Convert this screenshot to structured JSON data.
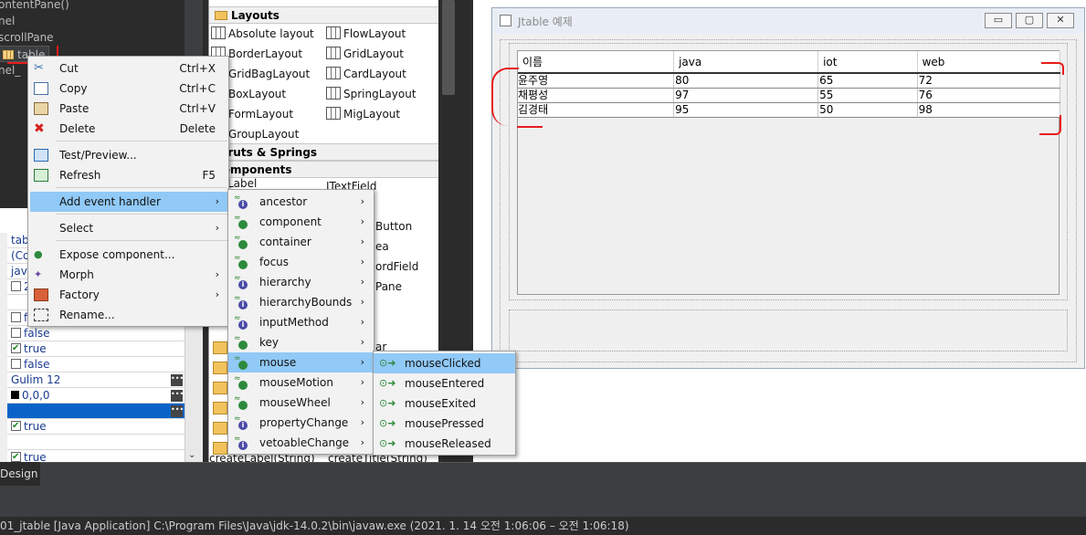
{
  "tree": {
    "items": [
      "ontentPane()",
      "nel",
      "scrollPane",
      "table",
      "nel_"
    ]
  },
  "props": {
    "rows": [
      {
        "text": "tab",
        "check": null
      },
      {
        "text": "(Co",
        "check": null
      },
      {
        "text": "java",
        "check": null
      },
      {
        "text": "2",
        "check": "off"
      },
      {
        "text": "",
        "check": null
      },
      {
        "text": "f",
        "check": "off"
      },
      {
        "text": "false",
        "check": "off"
      },
      {
        "text": "true",
        "check": "on"
      },
      {
        "text": "false",
        "check": "off"
      },
      {
        "text": "Gulim 12",
        "check": null,
        "dots": true
      },
      {
        "text": "0,0,0",
        "check": null,
        "dots": true,
        "swatch": true
      },
      {
        "text": "",
        "check": null,
        "dots": true,
        "selected": true
      },
      {
        "text": "true",
        "check": "on"
      },
      {
        "text": "",
        "check": null
      },
      {
        "text": "true",
        "check": "on"
      }
    ]
  },
  "palette": {
    "layouts_header": "Layouts",
    "layouts": [
      [
        "Absolute layout",
        "FlowLayout"
      ],
      [
        "BorderLayout",
        "GridLayout"
      ],
      [
        "GridBagLayout",
        "CardLayout"
      ],
      [
        "BoxLayout",
        "SpringLayout"
      ],
      [
        "FormLayout",
        "MigLayout"
      ],
      [
        "GroupLayout",
        ""
      ]
    ],
    "struts_header": "Struts & Springs",
    "components_header": "Components",
    "components_right": [
      "JTextField",
      "",
      "Button",
      "ea",
      "ordField",
      "Pane",
      "",
      "",
      "ar"
    ],
    "components_left_top": "Label",
    "bottom_row": [
      "createLabel(String)",
      "createTitle(String)"
    ]
  },
  "frame": {
    "title": "Jtable 예제",
    "btn_min": "▭",
    "btn_max": "▢",
    "btn_close": "✕"
  },
  "table": {
    "columns": [
      "이름",
      "java",
      "iot",
      "web"
    ],
    "rows": [
      [
        "윤주영",
        "80",
        "65",
        "72"
      ],
      [
        "채평성",
        "97",
        "55",
        "76"
      ],
      [
        "김경태",
        "95",
        "50",
        "98"
      ]
    ]
  },
  "context_menu": {
    "items": [
      {
        "label": "Cut",
        "shortcut": "Ctrl+X",
        "icon": "scissors-icon"
      },
      {
        "label": "Copy",
        "shortcut": "Ctrl+C",
        "icon": "copy-icon"
      },
      {
        "label": "Paste",
        "shortcut": "Ctrl+V",
        "icon": "paste-icon"
      },
      {
        "label": "Delete",
        "shortcut": "Delete",
        "icon": "delete-icon"
      },
      {
        "label": "Test/Preview...",
        "shortcut": "",
        "icon": "preview-icon"
      },
      {
        "label": "Refresh",
        "shortcut": "F5",
        "icon": "refresh-icon"
      },
      {
        "label": "Add event handler",
        "shortcut": "",
        "icon": "",
        "submenu": true
      },
      {
        "label": "Select",
        "shortcut": "",
        "icon": "",
        "submenu": true
      },
      {
        "label": "Expose component...",
        "shortcut": "",
        "icon": "expose-icon"
      },
      {
        "label": "Morph",
        "shortcut": "",
        "icon": "morph-icon",
        "submenu": true
      },
      {
        "label": "Factory",
        "shortcut": "",
        "icon": "factory-icon",
        "submenu": true
      },
      {
        "label": "Rename...",
        "shortcut": "",
        "icon": "rename-icon"
      }
    ]
  },
  "event_menu": {
    "items": [
      "ancestor",
      "component",
      "container",
      "focus",
      "hierarchy",
      "hierarchyBounds",
      "inputMethod",
      "key",
      "mouse",
      "mouseMotion",
      "mouseWheel",
      "propertyChange",
      "vetoableChange"
    ],
    "icon_kinds": [
      "i",
      "g",
      "g",
      "g",
      "i",
      "i",
      "i",
      "g",
      "g",
      "g",
      "g",
      "i",
      "i"
    ]
  },
  "mouse_menu": {
    "items": [
      "mouseClicked",
      "mouseEntered",
      "mouseExited",
      "mousePressed",
      "mouseReleased"
    ]
  },
  "bottom": {
    "design_tab": "Design",
    "console": "01_jtable [Java Application] C:\\Program Files\\Java\\jdk-14.0.2\\bin\\javaw.exe  (2021. 1. 14 오전 1:06:06 – 오전 1:06:18)"
  },
  "colors": {
    "menu_highlight": "#91c9f7",
    "annotation_red": "#e81c1c",
    "ide_dark": "#2b2b2b"
  }
}
